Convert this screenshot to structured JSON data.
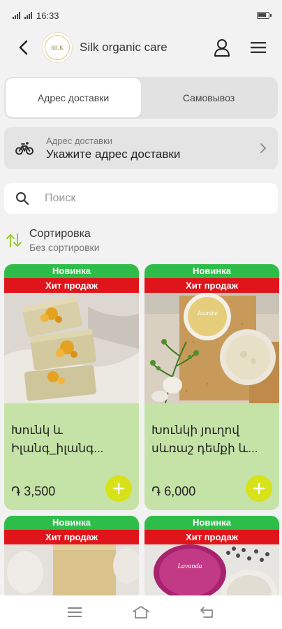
{
  "status_bar": {
    "time": "16:33",
    "network": "4G"
  },
  "header": {
    "brand_logo_text": "SILK",
    "title": "Silk organic care"
  },
  "tabs": [
    {
      "label": "Адрес доставки",
      "active": true
    },
    {
      "label": "Самовывоз",
      "active": false
    }
  ],
  "delivery": {
    "label": "Адрес доставки",
    "value": "Укажите адрес доставки"
  },
  "search": {
    "placeholder": "Поиск"
  },
  "sort": {
    "label": "Сортировка",
    "value": "Без сортировки"
  },
  "badges": {
    "new": "Новинка",
    "hit": "Хит продаж"
  },
  "products": [
    {
      "name": "Խունկ և Իլանգ_իլանգ...",
      "price": "֏ 3,500"
    },
    {
      "name": "Խունկի յուղով սևռաշ դեմքի և...",
      "price": "֏ 6,000"
    },
    {
      "name": "",
      "price": ""
    },
    {
      "name": "",
      "price": ""
    }
  ],
  "colors": {
    "card_bg": "#c5e3a6",
    "badge_new": "#2fbd4a",
    "badge_hit": "#e0151b",
    "add_button": "#d7e21a",
    "sort_icon": "#9acd32"
  },
  "icons": [
    "back-arrow",
    "user",
    "menu",
    "bicycle",
    "chevron-right",
    "search",
    "sort-arrows",
    "plus",
    "nav-menu",
    "nav-home",
    "nav-back"
  ]
}
